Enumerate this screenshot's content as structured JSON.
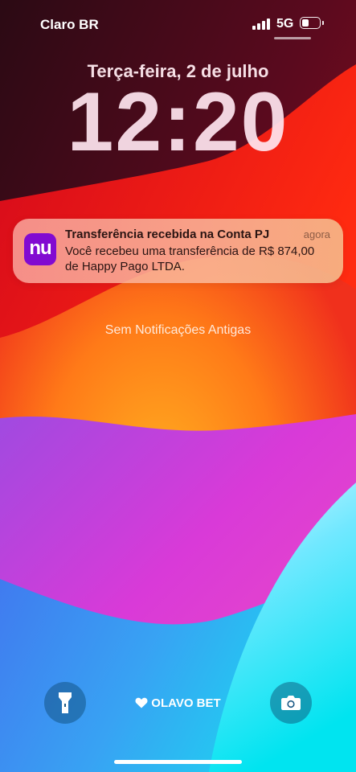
{
  "status_bar": {
    "carrier": "Claro BR",
    "network": "5G",
    "battery_level_percent": 45
  },
  "lock_screen": {
    "date": "Terça-feira, 2 de julho",
    "time": "12:20"
  },
  "notification": {
    "app_icon_text": "nu",
    "app_color": "#820ad1",
    "title": "Transferência recebida na Conta PJ",
    "time": "agora",
    "body": "Você recebeu uma transferência de R$ 874,00 de Happy Pago LTDA."
  },
  "no_older_notifications": "Sem Notificações Antigas",
  "bottom": {
    "flashlight_icon": "flashlight-icon",
    "camera_icon": "camera-icon",
    "now_playing_label": "OLAVO BET"
  }
}
